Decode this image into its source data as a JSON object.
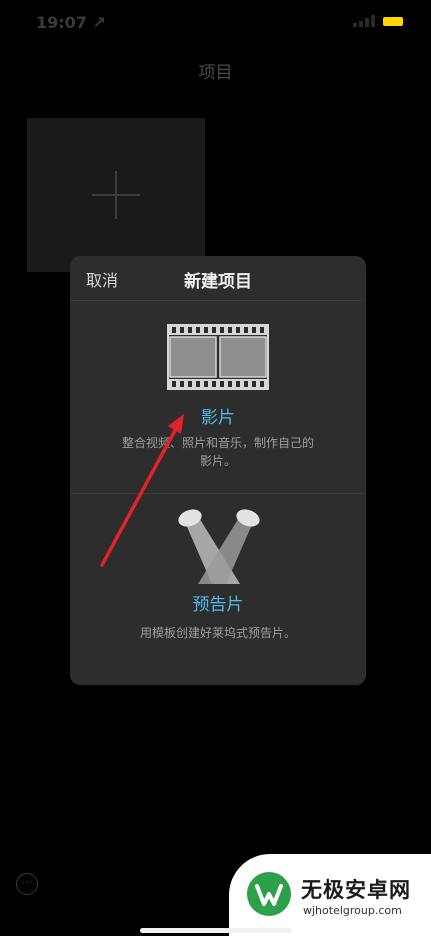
{
  "status_bar": {
    "time": "19:07 ↗",
    "signal_icon": "signal-icon",
    "battery_icon": "battery-icon",
    "battery_color": "#ffd60a"
  },
  "nav": {
    "title": "项目"
  },
  "projects": {
    "new_tile_icon": "plus-icon"
  },
  "modal": {
    "cancel_label": "取消",
    "title": "新建项目",
    "options": [
      {
        "icon": "film-icon",
        "label": "影片",
        "description": "整合视频、照片和音乐，制作自己的影片。"
      },
      {
        "icon": "spotlight-icon",
        "label": "预告片",
        "description": "用模板创建好莱坞式预告片。"
      }
    ],
    "accent_color": "#53b8e6"
  },
  "annotation": {
    "arrow_color": "#e0242b"
  },
  "bottom_bar": {
    "more_label": "···",
    "help_label": "?"
  },
  "watermark": {
    "name": "无极安卓网",
    "url": "wjhotelgroup.com"
  }
}
